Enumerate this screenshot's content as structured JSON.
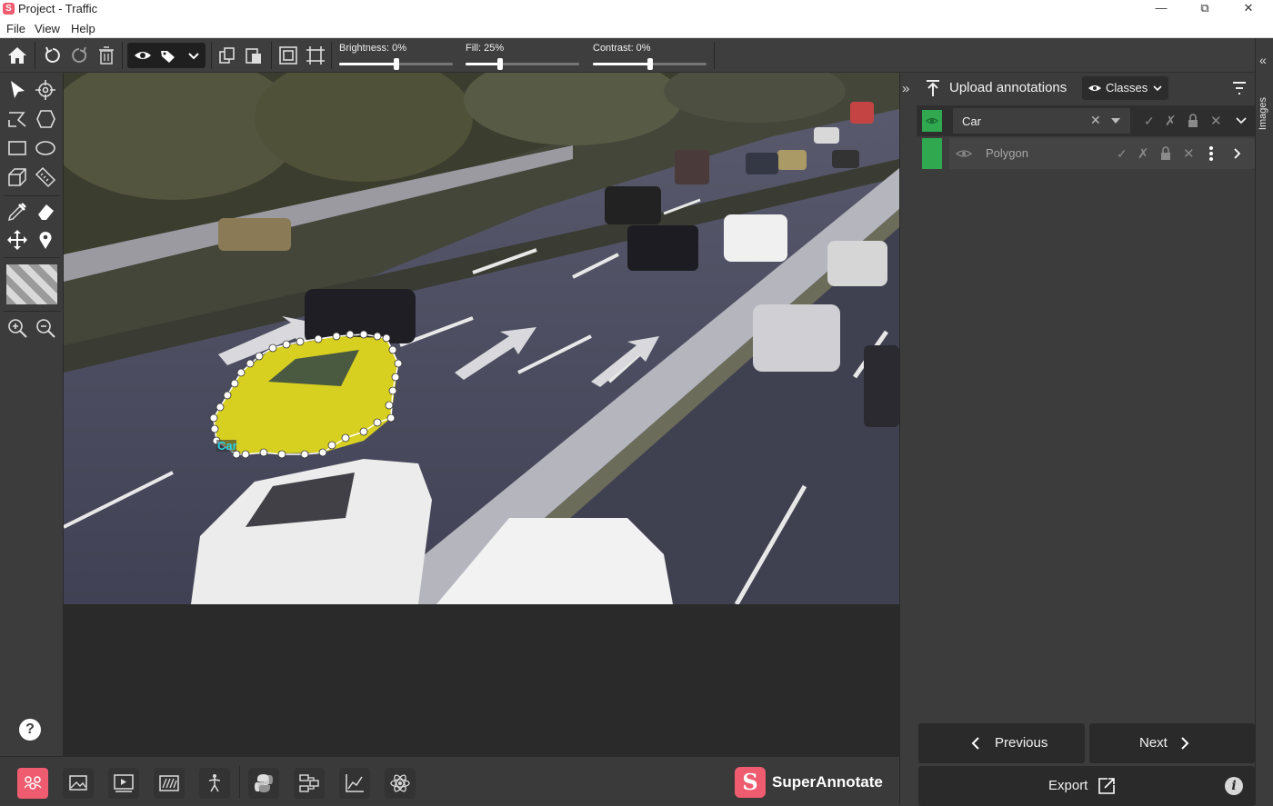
{
  "window": {
    "title": "Project - Traffic",
    "logo_letter": "S"
  },
  "menu": [
    "File",
    "View",
    "Help"
  ],
  "toolbar": {
    "sliders": [
      {
        "label": "Brightness: 0%",
        "value": 0.5
      },
      {
        "label": "Fill: 25%",
        "value": 0.3
      },
      {
        "label": "Contrast: 0%",
        "value": 0.5
      }
    ]
  },
  "annotation": {
    "label": "Car"
  },
  "right_panel": {
    "upload_label": "Upload annotations",
    "classes_label": "Classes",
    "class_row": {
      "name": "Car",
      "color": "#2fa84f"
    },
    "instance_row": {
      "name": "Polygon",
      "color": "#2fa84f"
    },
    "previous_label": "Previous",
    "next_label": "Next",
    "export_label": "Export",
    "images_tab": "Images"
  },
  "brand": {
    "name": "SuperAnnotate",
    "letter": "S",
    "color": "#ef5b6f"
  },
  "colors": {
    "accent": "#ef5b6f",
    "class_green": "#2fa84f",
    "panel": "#3c3c3c"
  },
  "icons": {
    "toolbar": [
      "home-icon",
      "undo-icon",
      "redo-icon",
      "trash-icon",
      "eye-icon",
      "tags-icon",
      "chevron-down-icon",
      "copy-icon",
      "paste-icon",
      "fit-icon",
      "fit-selection-icon"
    ],
    "left_tools": [
      "cursor-icon",
      "crosshair-icon",
      "polyline-icon",
      "polygon-icon",
      "rectangle-icon",
      "ellipse-icon",
      "cuboid-icon",
      "ruler-icon",
      "eyedropper-icon",
      "eraser-icon",
      "move-icon",
      "pin-icon",
      "pattern-swatch",
      "zoom-in-icon",
      "zoom-out-icon",
      "help-icon"
    ],
    "bottom": [
      "team-icon",
      "image-project-icon",
      "video-project-icon",
      "text-project-icon",
      "skeleton-icon",
      "python-icon",
      "workflow-icon",
      "chart-icon",
      "neural-icon"
    ]
  }
}
